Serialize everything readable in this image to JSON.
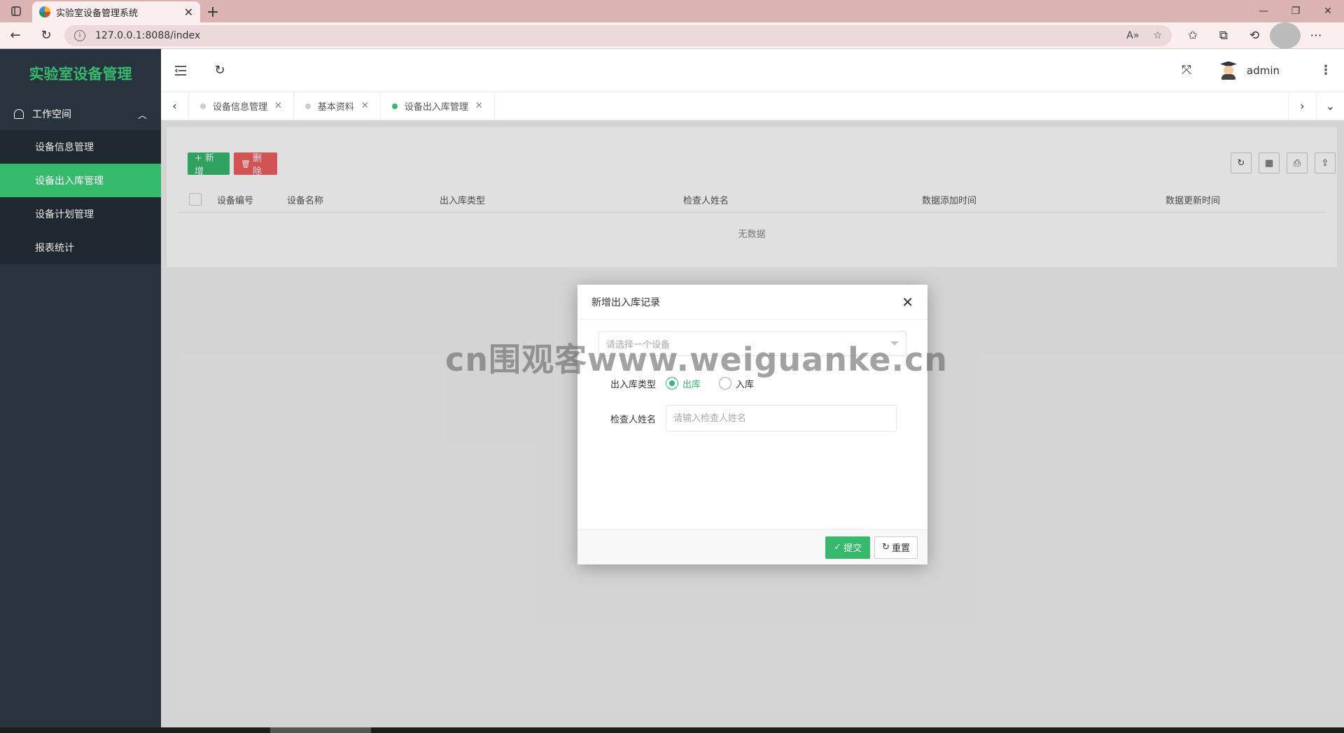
{
  "browser": {
    "tab_title": "实验室设备管理系统",
    "url": "127.0.0.1:8088/index"
  },
  "sidebar": {
    "logo": "实验室设备管理",
    "section": "工作空间",
    "items": [
      {
        "label": "设备信息管理"
      },
      {
        "label": "设备出入库管理"
      },
      {
        "label": "设备计划管理"
      },
      {
        "label": "报表统计"
      }
    ]
  },
  "header": {
    "username": "admin"
  },
  "page_tabs": [
    {
      "label": "设备信息管理"
    },
    {
      "label": "基本资料"
    },
    {
      "label": "设备出入库管理"
    }
  ],
  "toolbar": {
    "add_label": "+ 新增",
    "delete_label": "删除"
  },
  "table": {
    "columns": [
      "设备编号",
      "设备名称",
      "出入库类型",
      "检查人姓名",
      "数据添加时间",
      "数据更新时间"
    ],
    "empty_text": "无数据"
  },
  "modal": {
    "title": "新增出入库记录",
    "device_placeholder": "请选择一个设备",
    "type_label": "出入库类型",
    "type_options": [
      "出库",
      "入库"
    ],
    "inspector_label": "检查人姓名",
    "inspector_placeholder": "请输入检查人姓名",
    "submit_label": "提交",
    "reset_label": "重置"
  },
  "watermark": "cn围观客www.weiguanke.cn",
  "colors": {
    "accent": "#35b96b",
    "danger": "#ef5f5f",
    "sidebar_bg": "#28333e"
  }
}
